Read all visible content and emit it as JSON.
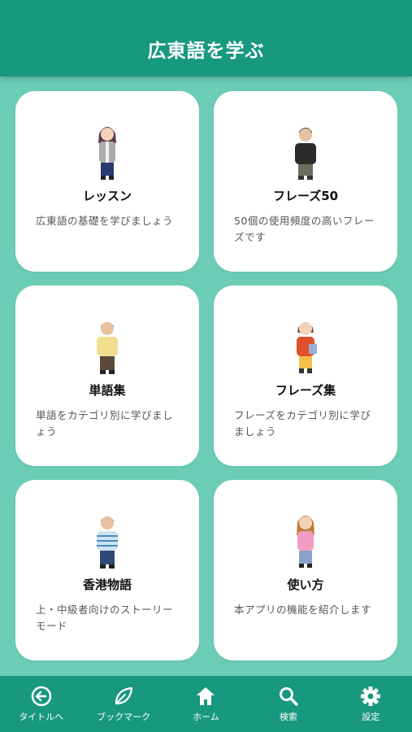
{
  "header": {
    "title": "広東語を学ぶ"
  },
  "cards": [
    {
      "title": "レッスン",
      "desc": "広東語の基礎を学びましょう",
      "avatar": "woman-grey-cardigan"
    },
    {
      "title": "フレーズ50",
      "desc": "50個の使用頻度の高いフレーズです",
      "avatar": "man-black-shirt"
    },
    {
      "title": "単語集",
      "desc": "単語をカテゴリ別に学びましょう",
      "avatar": "man-yellow-shirt"
    },
    {
      "title": "フレーズ集",
      "desc": "フレーズをカテゴリ別に学びましょう",
      "avatar": "woman-red-top"
    },
    {
      "title": "香港物語",
      "desc": "上・中級者向けのストーリーモード",
      "avatar": "man-striped-shirt"
    },
    {
      "title": "使い方",
      "desc": "本アプリの機能を紹介します",
      "avatar": "woman-pink-cardigan"
    }
  ],
  "nav": [
    {
      "label": "タイトルへ",
      "icon": "back-arrow-icon"
    },
    {
      "label": "ブックマーク",
      "icon": "leaf-icon"
    },
    {
      "label": "ホーム",
      "icon": "home-icon"
    },
    {
      "label": "検索",
      "icon": "search-icon"
    },
    {
      "label": "設定",
      "icon": "gear-icon"
    }
  ],
  "colors": {
    "header": "#18987f",
    "background": "#6ccdb5",
    "card": "#ffffff"
  }
}
